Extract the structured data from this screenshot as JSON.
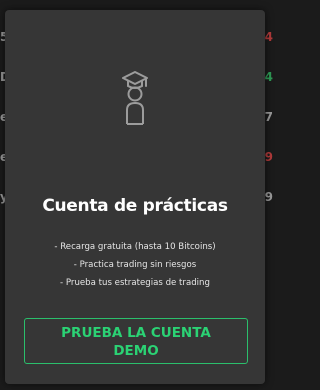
{
  "background": {
    "left_fragments": [
      "5",
      "D",
      "er",
      "er",
      "y"
    ],
    "right_fragments": [
      {
        "text": "4",
        "color": "#b03a3a"
      },
      {
        "text": "4",
        "color": "#2e9a55"
      },
      {
        "text": "7",
        "color": "#9a9a9a"
      },
      {
        "text": "9",
        "color": "#b03a3a"
      },
      {
        "text": "9",
        "color": "#9a9a9a"
      }
    ]
  },
  "modal": {
    "icon": "graduate-user-icon",
    "title": "Cuenta de prácticas",
    "features": [
      "- Recarga gratuita (hasta 10 Bitcoins)",
      "- Practica trading sin riesgos",
      "- Prueba tus estrategias de trading"
    ],
    "cta_label": "PRUEBA LA CUENTA DEMO",
    "colors": {
      "modal_bg": "#363636",
      "accent": "#2bd274"
    }
  }
}
